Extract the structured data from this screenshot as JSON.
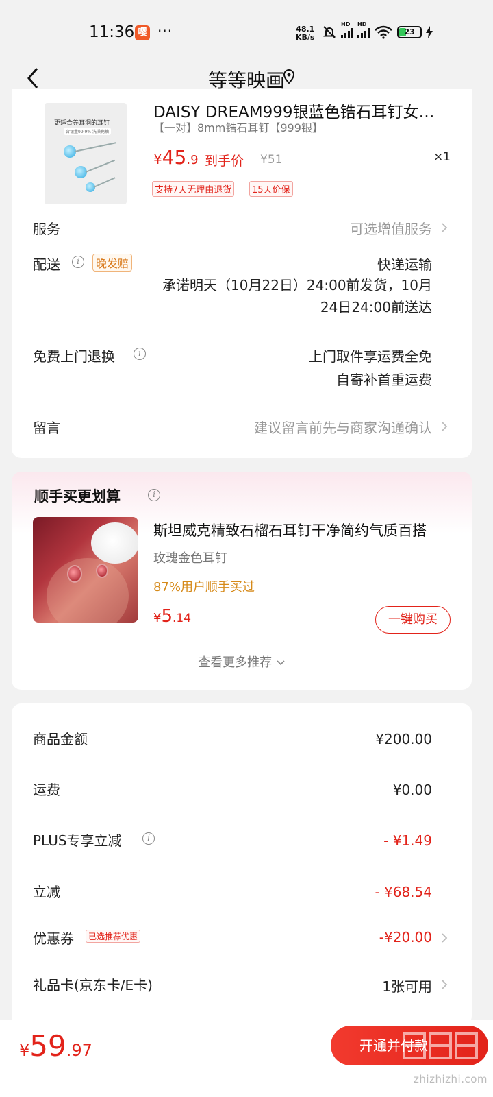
{
  "status_bar": {
    "time": "11:36",
    "dots": "···",
    "speed_top": "48.1",
    "speed_bottom": "KB/s",
    "battery": "23",
    "app_icon": "app-notification-icon"
  },
  "header": {
    "title": "等等映画",
    "back_icon": "back-arrow-icon",
    "location_icon": "location-pin-icon"
  },
  "product": {
    "title": "DAISY DREAM999银蓝色锆石耳钉女养耳洞",
    "spec": "【一对】8mm锆石耳钉【999银】",
    "price_symbol": "¥",
    "price_int": "45",
    "price_dec": ".9",
    "price_label": "到手价",
    "original_price": "¥51",
    "quantity": "×1",
    "image_caption": "更适合养耳洞的耳钉",
    "image_sub": "含银量99.9% 洗澡免摘",
    "tags": [
      "支持7天无理由退货",
      "15天价保"
    ]
  },
  "rows": {
    "service_label": "服务",
    "service_value": "可选增值服务",
    "delivery_label": "配送",
    "delivery_tag": "晚发赔",
    "delivery_method": "快递运输",
    "delivery_promise_1": "承诺明天（10月22日）24:00前发货，10月",
    "delivery_promise_2": "24日24:00前送达",
    "return_label": "免费上门退换",
    "return_value_1": "上门取件享运费全免",
    "return_value_2": "自寄补首重运费",
    "note_label": "留言",
    "note_placeholder": "建议留言前先与商家沟通确认"
  },
  "recommend": {
    "title": "顺手买更划算",
    "item_title": "斯坦威克精致石榴石耳钉干净简约气质百搭",
    "item_spec": "玫瑰金色耳钉",
    "item_bought": "87%用户顺手买过",
    "price_symbol": "¥",
    "price_int": "5",
    "price_dec": ".14",
    "buy_label": "一键购买",
    "more_label": "查看更多推荐"
  },
  "summary": {
    "items": [
      {
        "label": "商品金额",
        "value": "¥200.00"
      },
      {
        "label": "运费",
        "value": "¥0.00"
      },
      {
        "label": "PLUS专享立减",
        "value": "- ¥1.49"
      },
      {
        "label": "立减",
        "value": "- ¥68.54"
      },
      {
        "label": "优惠券",
        "value": "-¥20.00"
      },
      {
        "label": "礼品卡(京东卡/E卡)",
        "value": "1张可用"
      }
    ],
    "coupon_tag": "已选推荐优惠"
  },
  "bottom": {
    "symbol": "¥",
    "total_int": "59",
    "total_dec": ".97",
    "pay_label": "开通并付款",
    "watermark_url": "zhizhizhi.com"
  },
  "colors": {
    "accent_red": "#e2231a",
    "orange": "#d68a1a",
    "background": "#f2f2f2"
  }
}
